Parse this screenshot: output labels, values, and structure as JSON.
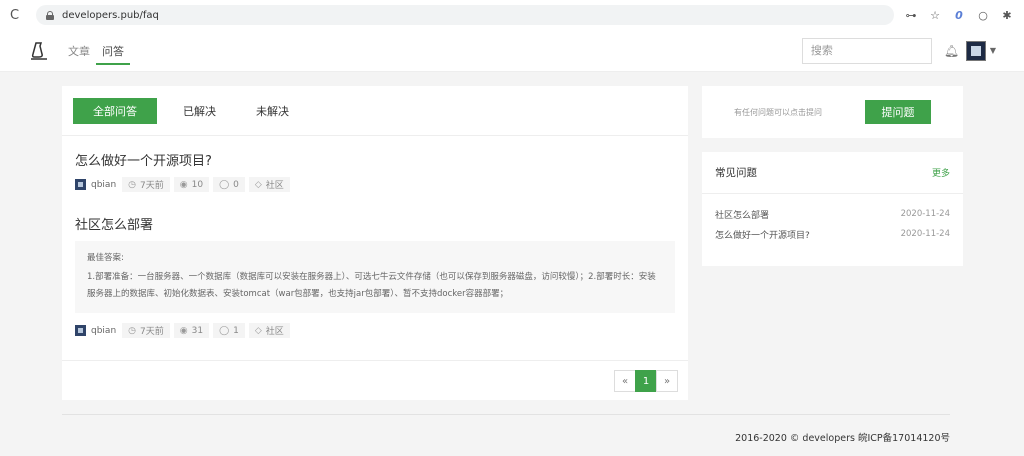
{
  "browser": {
    "url": "developers.pub/faq"
  },
  "header": {
    "nav": [
      {
        "label": "文章"
      },
      {
        "label": "问答"
      }
    ],
    "search_placeholder": "搜索"
  },
  "tabs": [
    {
      "label": "全部问答"
    },
    {
      "label": "已解决"
    },
    {
      "label": "未解决"
    }
  ],
  "questions": [
    {
      "title": "怎么做好一个开源项目?",
      "user": "qbian",
      "time": "7天前",
      "views": "10",
      "comments": "0",
      "tag": "社区"
    },
    {
      "title": "社区怎么部署",
      "answer_label": "最佳答案:",
      "answer_text": "1.部署准备：一台服务器、一个数据库（数据库可以安装在服务器上）、可选七牛云文件存储（也可以保存到服务器磁盘，访问较慢）；2.部署时长：安装服务器上的数据库、初始化数据表、安装tomcat（war包部署，也支持jar包部署）、暂不支持docker容器部署；",
      "user": "qbian",
      "time": "7天前",
      "views": "31",
      "comments": "1",
      "tag": "社区"
    }
  ],
  "pagination": {
    "prev": "«",
    "current": "1",
    "next": "»"
  },
  "ask": {
    "hint": "有任何问题可以点击提问",
    "button": "提问题"
  },
  "faq": {
    "title": "常见问题",
    "more": "更多",
    "items": [
      {
        "question": "社区怎么部署",
        "date": "2020-11-24"
      },
      {
        "question": "怎么做好一个开源项目?",
        "date": "2020-11-24"
      }
    ]
  },
  "footer": {
    "text": "2016-2020 © developers 皖ICP备17014120号"
  },
  "colors": {
    "accent": "#3fa24a",
    "background": "#f4f4f4"
  }
}
